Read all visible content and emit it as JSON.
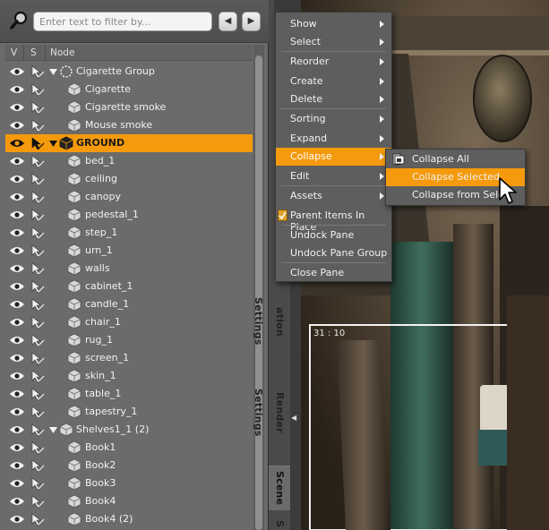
{
  "filter": {
    "placeholder": "Enter text to filter by..."
  },
  "columns": {
    "v": "V",
    "s": "S",
    "node": "Node"
  },
  "nodes": [
    {
      "label": "Cigarette  Group",
      "depth": 0,
      "expander": "open",
      "icon": "group-null-icon",
      "selected": false
    },
    {
      "label": "Cigarette",
      "depth": 1,
      "expander": "none",
      "icon": "prop-cube-icon",
      "selected": false
    },
    {
      "label": "Cigarette smoke",
      "depth": 1,
      "expander": "none",
      "icon": "prop-cube-icon",
      "selected": false
    },
    {
      "label": "Mouse smoke",
      "depth": 1,
      "expander": "none",
      "icon": "prop-cube-icon",
      "selected": false
    },
    {
      "label": "GROUND",
      "depth": 0,
      "expander": "open",
      "icon": "prop-cube-icon",
      "selected": true
    },
    {
      "label": "bed_1",
      "depth": 1,
      "expander": "none",
      "icon": "prop-cube-icon",
      "selected": false
    },
    {
      "label": "ceiling",
      "depth": 1,
      "expander": "none",
      "icon": "prop-cube-icon",
      "selected": false
    },
    {
      "label": "canopy",
      "depth": 1,
      "expander": "none",
      "icon": "prop-cube-icon",
      "selected": false
    },
    {
      "label": "pedestal_1",
      "depth": 1,
      "expander": "none",
      "icon": "prop-cube-icon",
      "selected": false
    },
    {
      "label": "step_1",
      "depth": 1,
      "expander": "none",
      "icon": "prop-cube-icon",
      "selected": false
    },
    {
      "label": "urn_1",
      "depth": 1,
      "expander": "none",
      "icon": "prop-cube-icon",
      "selected": false
    },
    {
      "label": "walls",
      "depth": 1,
      "expander": "none",
      "icon": "prop-cube-icon",
      "selected": false
    },
    {
      "label": "cabinet_1",
      "depth": 1,
      "expander": "none",
      "icon": "prop-cube-icon",
      "selected": false
    },
    {
      "label": "candle_1",
      "depth": 1,
      "expander": "none",
      "icon": "prop-cube-icon",
      "selected": false
    },
    {
      "label": "chair_1",
      "depth": 1,
      "expander": "none",
      "icon": "prop-cube-icon",
      "selected": false
    },
    {
      "label": "rug_1",
      "depth": 1,
      "expander": "none",
      "icon": "prop-cube-icon",
      "selected": false
    },
    {
      "label": "screen_1",
      "depth": 1,
      "expander": "none",
      "icon": "prop-cube-icon",
      "selected": false
    },
    {
      "label": "skin_1",
      "depth": 1,
      "expander": "none",
      "icon": "prop-cube-icon",
      "selected": false
    },
    {
      "label": "table_1",
      "depth": 1,
      "expander": "none",
      "icon": "prop-cube-icon",
      "selected": false
    },
    {
      "label": "tapestry_1",
      "depth": 1,
      "expander": "none",
      "icon": "prop-cube-icon",
      "selected": false
    },
    {
      "label": "Shelves1_1 (2)",
      "depth": 0,
      "expander": "open",
      "icon": "prop-cube-icon",
      "selected": false
    },
    {
      "label": "Book1",
      "depth": 1,
      "expander": "none",
      "icon": "prop-cube-icon",
      "selected": false
    },
    {
      "label": "Book2",
      "depth": 1,
      "expander": "none",
      "icon": "prop-cube-icon",
      "selected": false
    },
    {
      "label": "Book3",
      "depth": 1,
      "expander": "none",
      "icon": "prop-cube-icon",
      "selected": false
    },
    {
      "label": "Book4",
      "depth": 1,
      "expander": "none",
      "icon": "prop-cube-icon",
      "selected": false
    },
    {
      "label": "Book4 (2)",
      "depth": 1,
      "expander": "none",
      "icon": "prop-cube-icon",
      "selected": false
    }
  ],
  "side_tabs": [
    {
      "label": "ation Settings",
      "active": false
    },
    {
      "label": "Render Settings",
      "active": false
    },
    {
      "label": "Scene",
      "active": true
    },
    {
      "label": "S",
      "active": false
    }
  ],
  "viewport": {
    "frame_label": "31 : 10"
  },
  "context_menu": [
    {
      "label": "Show",
      "submenu": true
    },
    {
      "label": "Select",
      "submenu": true
    },
    {
      "label": "Reorder",
      "submenu": true
    },
    {
      "label": "Create",
      "submenu": true
    },
    {
      "label": "Delete",
      "submenu": true
    },
    {
      "label": "Sorting",
      "submenu": true
    },
    {
      "label": "Expand",
      "submenu": true
    },
    {
      "label": "Collapse",
      "submenu": true,
      "highlighted": true
    },
    {
      "label": "Edit",
      "submenu": true
    },
    {
      "label": "Assets",
      "submenu": true
    },
    {
      "label": "Parent Items In Place",
      "submenu": false,
      "checked": true
    },
    {
      "label": "Undock Pane",
      "submenu": false
    },
    {
      "label": "Undock Pane Group",
      "submenu": false
    },
    {
      "label": "Close Pane",
      "submenu": false
    }
  ],
  "collapse_submenu": [
    {
      "label": "Collapse All",
      "highlighted": false
    },
    {
      "label": "Collapse Selected",
      "highlighted": true
    },
    {
      "label": "Collapse from Selec",
      "highlighted": false
    }
  ],
  "colors": {
    "selection": "#f59a0c",
    "pane_bg": "#6b6b6b",
    "menu_bg": "#5e5e5e"
  }
}
